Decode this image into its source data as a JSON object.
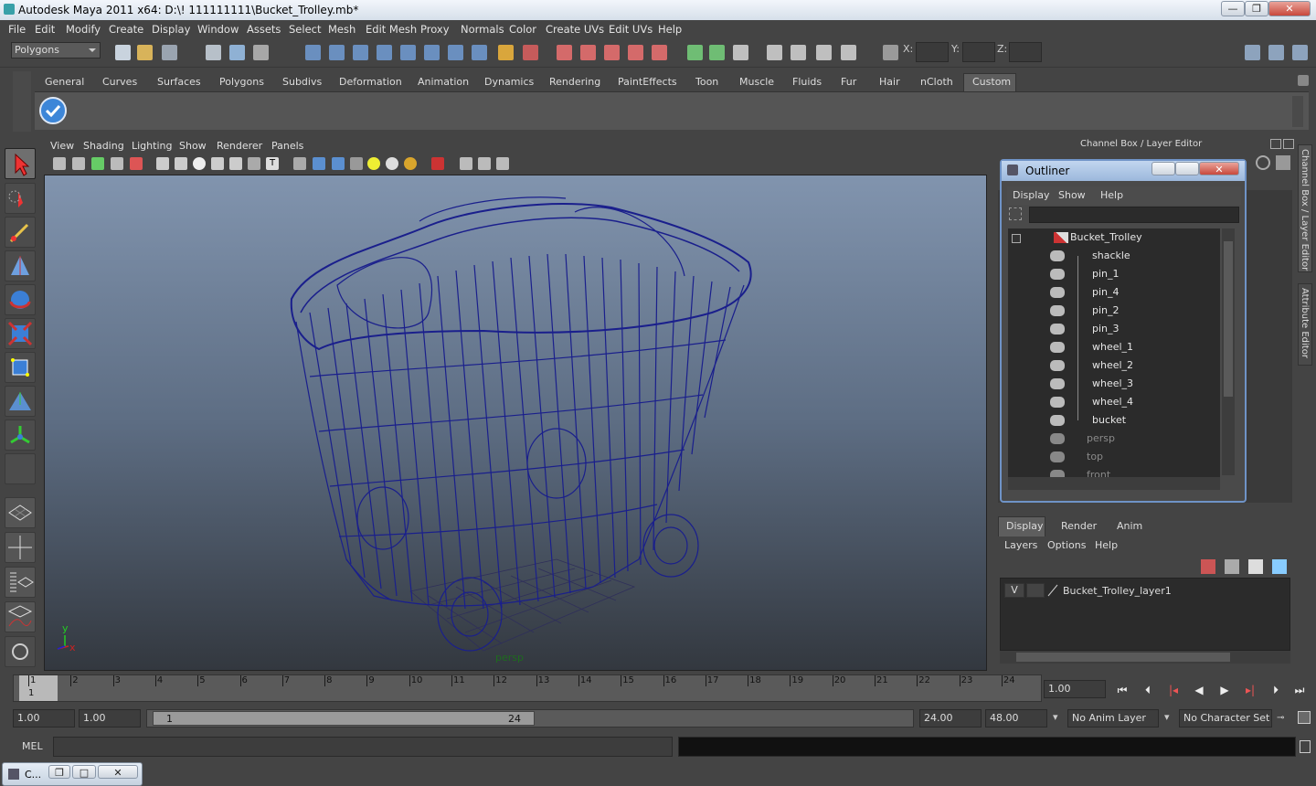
{
  "window": {
    "title": "Autodesk Maya 2011 x64: D:\\! 111111111\\Bucket_Trolley.mb*",
    "min": "—",
    "max": "❐",
    "close": "✕"
  },
  "menubar": [
    "File",
    "Edit",
    "Modify",
    "Create",
    "Display",
    "Window",
    "Assets",
    "Select",
    "Mesh",
    "Edit Mesh",
    "Proxy",
    "Normals",
    "Color",
    "Create UVs",
    "Edit UVs",
    "Help"
  ],
  "status": {
    "mode": "Polygons",
    "x_label": "X:",
    "y_label": "Y:",
    "z_label": "Z:"
  },
  "shelf": {
    "tabs": [
      "General",
      "Curves",
      "Surfaces",
      "Polygons",
      "Subdivs",
      "Deformation",
      "Animation",
      "Dynamics",
      "Rendering",
      "PaintEffects",
      "Toon",
      "Muscle",
      "Fluids",
      "Fur",
      "Hair",
      "nCloth",
      "Custom"
    ],
    "active": "Custom"
  },
  "viewport": {
    "menus": [
      "View",
      "Shading",
      "Lighting",
      "Show",
      "Renderer",
      "Panels"
    ],
    "camera_label": "persp",
    "axis_y": "y",
    "axis_x": "x"
  },
  "right_panel": {
    "header": "Channel Box / Layer Editor",
    "side_tab_1": "Channel Box / Layer Editor",
    "side_tab_2": "Attribute Editor"
  },
  "outliner": {
    "title": "Outliner",
    "menus": [
      "Display",
      "Show",
      "Help"
    ],
    "items": [
      {
        "label": "Bucket_Trolley",
        "level": 0
      },
      {
        "label": "shackle",
        "level": 1
      },
      {
        "label": "pin_1",
        "level": 1
      },
      {
        "label": "pin_4",
        "level": 1
      },
      {
        "label": "pin_2",
        "level": 1
      },
      {
        "label": "pin_3",
        "level": 1
      },
      {
        "label": "wheel_1",
        "level": 1
      },
      {
        "label": "wheel_2",
        "level": 1
      },
      {
        "label": "wheel_3",
        "level": 1
      },
      {
        "label": "wheel_4",
        "level": 1
      },
      {
        "label": "bucket",
        "level": 1
      },
      {
        "label": "persp",
        "level": -1
      },
      {
        "label": "top",
        "level": -1
      },
      {
        "label": "front",
        "level": -1
      }
    ]
  },
  "layers": {
    "tabs": [
      "Display",
      "Render",
      "Anim"
    ],
    "active_tab": "Display",
    "menus": [
      "Layers",
      "Options",
      "Help"
    ],
    "layer_vis": "V",
    "layer_name": "Bucket_Trolley_layer1"
  },
  "timeline": {
    "ticks": [
      "1",
      "2",
      "3",
      "4",
      "5",
      "6",
      "7",
      "8",
      "9",
      "10",
      "11",
      "12",
      "13",
      "14",
      "15",
      "16",
      "17",
      "18",
      "19",
      "20",
      "21",
      "22",
      "23",
      "24"
    ],
    "current_marker": "1",
    "current_frame": "1.00"
  },
  "range": {
    "start": "1.00",
    "playback_start": "1.00",
    "slider_start": "1",
    "slider_end": "24",
    "playback_end": "24.00",
    "end": "48.00",
    "anim_layer": "No Anim Layer",
    "char_set": "No Character Set"
  },
  "mel": {
    "label": "MEL"
  },
  "taskbar": {
    "item": "C..."
  }
}
